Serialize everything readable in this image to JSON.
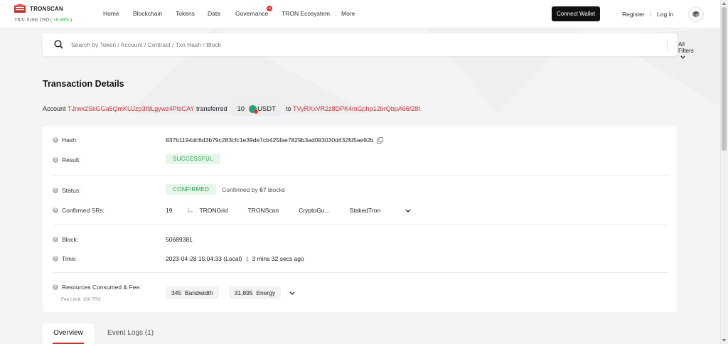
{
  "header": {
    "brand": "TRONSCAN",
    "price_label": "TRX: 0.066 USD",
    "price_change": "( +0.98% )",
    "nav": [
      "Home",
      "Blockchain",
      "Tokens",
      "Data",
      "Governance",
      "TRON Ecosystem",
      "More"
    ],
    "connect_wallet": "Connect Wallet",
    "register": "Register",
    "login": "Log in"
  },
  "search": {
    "placeholder": "Search by Token / Account / Contract / Txn Hash / Block",
    "filters_label": "All Filters"
  },
  "page": {
    "title": "Transaction Details",
    "transfer": {
      "prefix": "Account",
      "from": "TJrwx2SkGGa5QmKUJzp3t9Lgywz4PtsCAY",
      "verb": "transferred",
      "amount": "10",
      "token": "USDT",
      "to_word": "to",
      "to": "TVyRXxVR2z8DPK4mGphp12brQbpA66f28t"
    }
  },
  "details": {
    "hash_label": "Hash:",
    "hash_value": "837b1194dc6d3b79c283cfc1e39de7cb425fae7829b3ad093030d432fd5ae92b",
    "result_label": "Result:",
    "result_value": "SUCCESSFUL",
    "status_label": "Status:",
    "status_value": "CONFIRMED",
    "confirmed_by_prefix": "Confirmed by",
    "confirmed_blocks": "67",
    "confirmed_by_suffix": "blocks",
    "srs_label": "Confirmed SRs:",
    "srs_count": "19",
    "srs": [
      "TRONGrid",
      "TRONScan",
      "CryptoGu...",
      "StakedTron"
    ],
    "block_label": "Block:",
    "block_value": "50689381",
    "time_label": "Time:",
    "time_value": "2023-04-28 15:04:33 (Local)",
    "time_sep": "|",
    "time_ago": "3 mins 32 secs ago",
    "resources_label": "Resources Consumed & Fee:",
    "fee_limit": "Fee Limit: 100 TRX",
    "bandwidth_value": "345",
    "bandwidth_label": "Bandwidth",
    "energy_value": "31,895",
    "energy_label": "Energy"
  },
  "tabs": {
    "overview": "Overview",
    "event_logs": "Event Logs (1)"
  },
  "colors": {
    "accent_red": "#c23631",
    "success_green": "#2f9e4f",
    "button_dark": "#111111"
  }
}
